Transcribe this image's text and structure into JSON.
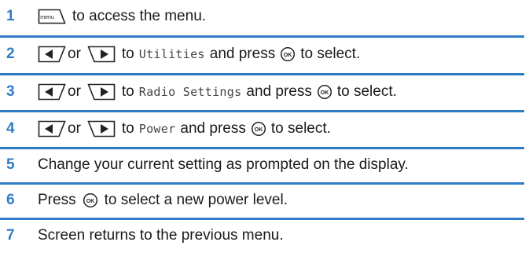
{
  "steps": [
    {
      "number": "1",
      "text_a": "to access the menu."
    },
    {
      "number": "2",
      "or": "or",
      "to": "to",
      "menu_item": "Utilities",
      "text_mid": "and press",
      "text_end": "to select."
    },
    {
      "number": "3",
      "or": "or",
      "to": "to",
      "menu_item": "Radio Settings",
      "text_mid": "and press",
      "text_end": "to select."
    },
    {
      "number": "4",
      "or": "or",
      "to": "to",
      "menu_item": "Power",
      "text_mid": "and press",
      "text_end": "to select."
    },
    {
      "number": "5",
      "text_a": "Change your current setting as prompted on the display."
    },
    {
      "number": "6",
      "text_a": "Press",
      "text_end": "to select a new power level."
    },
    {
      "number": "7",
      "text_a": "Screen returns to the previous menu."
    }
  ],
  "icons": {
    "menu_key_label": "menu",
    "left_arrow": "left-arrow-key",
    "right_arrow": "right-arrow-key",
    "ok_key_label": "OK"
  },
  "colors": {
    "accent": "#2e7cc7",
    "text": "#1a1a1a",
    "mono_text": "#444444"
  }
}
